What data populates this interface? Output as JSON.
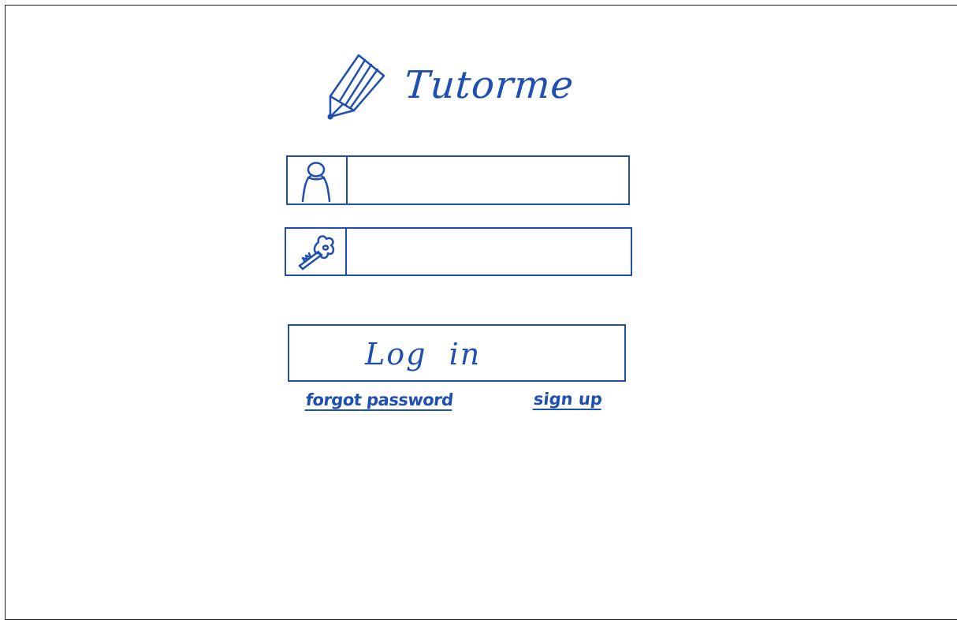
{
  "app": {
    "brand_name": "Tutorme",
    "brand_icon": "pencil-icon",
    "accent_color": "#1f4fb0"
  },
  "login_form": {
    "username": {
      "icon": "user-icon",
      "value": "",
      "placeholder": ""
    },
    "password": {
      "icon": "key-icon",
      "value": "",
      "placeholder": ""
    },
    "login_button_label": "Log  in",
    "forgot_password_label": "forgot password",
    "sign_up_label": "sign up"
  }
}
